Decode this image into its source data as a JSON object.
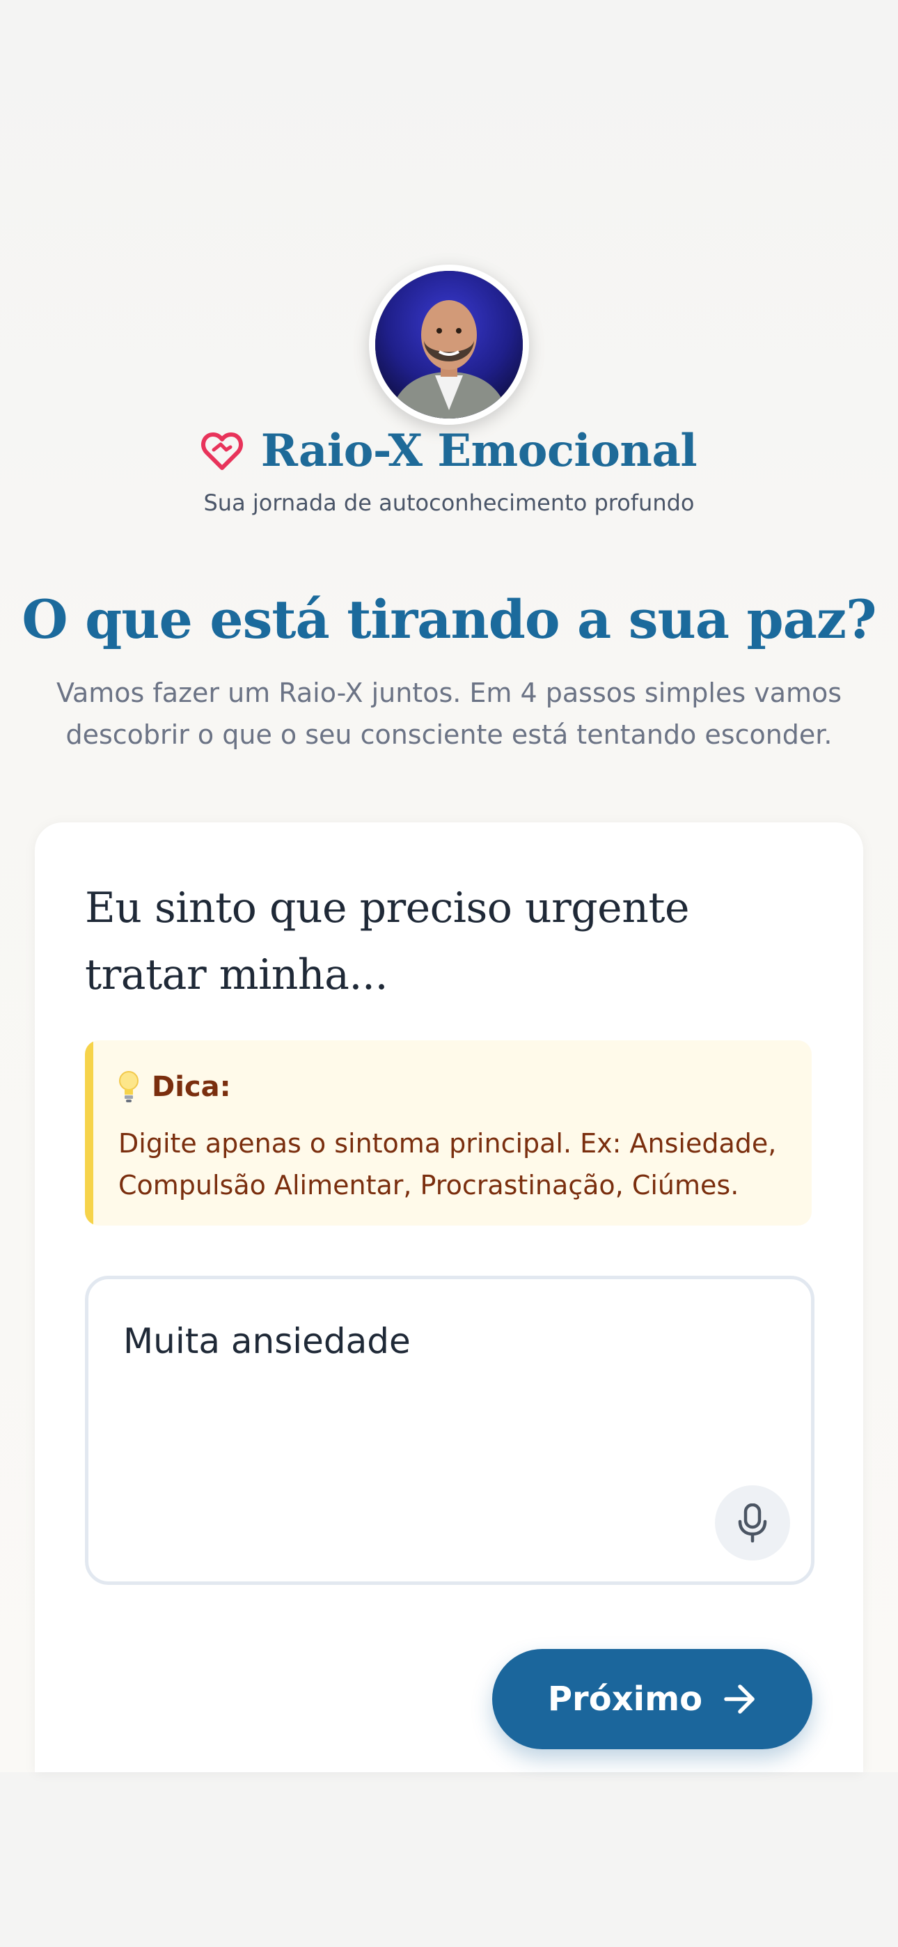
{
  "brand": {
    "title": "Raio-X Emocional",
    "tagline": "Sua jornada de autoconhecimento profundo",
    "heart_color": "#e8335a",
    "title_color": "#1e6a98"
  },
  "hero": {
    "headline": "O que está tirando a sua paz?",
    "subtitle": "Vamos fazer um Raio-X juntos. Em 4 passos simples vamos descobrir o que o seu consciente está tentando esconder."
  },
  "step": {
    "question": "Eu sinto que preciso urgente tratar minha...",
    "tip": {
      "title": "Dica:",
      "text": "Digite apenas o sintoma principal. Ex: Ansiedade, Compulsão Alimentar, Procrastinação, Ciúmes."
    },
    "answer": {
      "value": "Muita ansiedade",
      "icon": "microphone-icon"
    },
    "next_button": {
      "label": "Próximo",
      "icon": "arrow-right-icon",
      "color": "#1b669c"
    }
  }
}
